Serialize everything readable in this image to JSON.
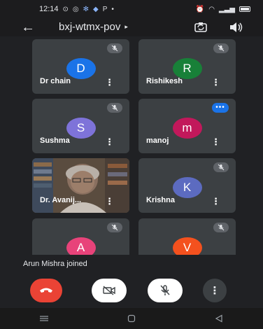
{
  "status_bar": {
    "time": "12:14",
    "left_indicators": "P",
    "accent": "#8ab4f8"
  },
  "header": {
    "title": "bxj-wtmx-pov",
    "title_caret": "▸",
    "back_icon": "arrow-left-icon",
    "switch_camera_icon": "switch-camera-icon",
    "audio_icon": "speaker-icon"
  },
  "participants": [
    {
      "name": "Dr chain",
      "initial": "D",
      "color": "#1a73e8",
      "muted": true
    },
    {
      "name": "Rishikesh",
      "initial": "R",
      "color": "#188038",
      "muted": true
    },
    {
      "name": "Sushma",
      "initial": "S",
      "color": "#7e73d9",
      "muted": true
    },
    {
      "name": "manoj",
      "initial": "m",
      "color": "#c2185b",
      "muted": false,
      "speaking": true
    },
    {
      "name": "Dr. Avanij...",
      "video": true,
      "muted": false
    },
    {
      "name": "Krishna",
      "initial": "K",
      "color": "#5c6bc0",
      "muted": true
    },
    {
      "name": "",
      "initial": "A",
      "color": "#e8437a",
      "muted": true
    },
    {
      "name": "",
      "initial": "V",
      "color": "#f4511e",
      "muted": true
    }
  ],
  "more_label": "⋮",
  "toast": "Arun Mishra joined",
  "controls": {
    "end_call_color": "#ea4335",
    "more_label": "⋮"
  }
}
